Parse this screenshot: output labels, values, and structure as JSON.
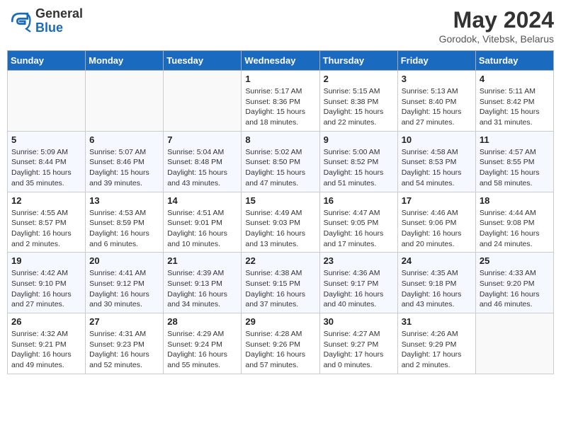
{
  "header": {
    "logo": {
      "line1": "General",
      "line2": "Blue"
    },
    "title": "May 2024",
    "location": "Gorodok, Vitebsk, Belarus"
  },
  "weekdays": [
    "Sunday",
    "Monday",
    "Tuesday",
    "Wednesday",
    "Thursday",
    "Friday",
    "Saturday"
  ],
  "weeks": [
    [
      {
        "day": "",
        "sunrise": "",
        "sunset": "",
        "daylight": ""
      },
      {
        "day": "",
        "sunrise": "",
        "sunset": "",
        "daylight": ""
      },
      {
        "day": "",
        "sunrise": "",
        "sunset": "",
        "daylight": ""
      },
      {
        "day": "1",
        "sunrise": "5:17 AM",
        "sunset": "8:36 PM",
        "daylight": "15 hours and 18 minutes."
      },
      {
        "day": "2",
        "sunrise": "5:15 AM",
        "sunset": "8:38 PM",
        "daylight": "15 hours and 22 minutes."
      },
      {
        "day": "3",
        "sunrise": "5:13 AM",
        "sunset": "8:40 PM",
        "daylight": "15 hours and 27 minutes."
      },
      {
        "day": "4",
        "sunrise": "5:11 AM",
        "sunset": "8:42 PM",
        "daylight": "15 hours and 31 minutes."
      }
    ],
    [
      {
        "day": "5",
        "sunrise": "5:09 AM",
        "sunset": "8:44 PM",
        "daylight": "15 hours and 35 minutes."
      },
      {
        "day": "6",
        "sunrise": "5:07 AM",
        "sunset": "8:46 PM",
        "daylight": "15 hours and 39 minutes."
      },
      {
        "day": "7",
        "sunrise": "5:04 AM",
        "sunset": "8:48 PM",
        "daylight": "15 hours and 43 minutes."
      },
      {
        "day": "8",
        "sunrise": "5:02 AM",
        "sunset": "8:50 PM",
        "daylight": "15 hours and 47 minutes."
      },
      {
        "day": "9",
        "sunrise": "5:00 AM",
        "sunset": "8:52 PM",
        "daylight": "15 hours and 51 minutes."
      },
      {
        "day": "10",
        "sunrise": "4:58 AM",
        "sunset": "8:53 PM",
        "daylight": "15 hours and 54 minutes."
      },
      {
        "day": "11",
        "sunrise": "4:57 AM",
        "sunset": "8:55 PM",
        "daylight": "15 hours and 58 minutes."
      }
    ],
    [
      {
        "day": "12",
        "sunrise": "4:55 AM",
        "sunset": "8:57 PM",
        "daylight": "16 hours and 2 minutes."
      },
      {
        "day": "13",
        "sunrise": "4:53 AM",
        "sunset": "8:59 PM",
        "daylight": "16 hours and 6 minutes."
      },
      {
        "day": "14",
        "sunrise": "4:51 AM",
        "sunset": "9:01 PM",
        "daylight": "16 hours and 10 minutes."
      },
      {
        "day": "15",
        "sunrise": "4:49 AM",
        "sunset": "9:03 PM",
        "daylight": "16 hours and 13 minutes."
      },
      {
        "day": "16",
        "sunrise": "4:47 AM",
        "sunset": "9:05 PM",
        "daylight": "16 hours and 17 minutes."
      },
      {
        "day": "17",
        "sunrise": "4:46 AM",
        "sunset": "9:06 PM",
        "daylight": "16 hours and 20 minutes."
      },
      {
        "day": "18",
        "sunrise": "4:44 AM",
        "sunset": "9:08 PM",
        "daylight": "16 hours and 24 minutes."
      }
    ],
    [
      {
        "day": "19",
        "sunrise": "4:42 AM",
        "sunset": "9:10 PM",
        "daylight": "16 hours and 27 minutes."
      },
      {
        "day": "20",
        "sunrise": "4:41 AM",
        "sunset": "9:12 PM",
        "daylight": "16 hours and 30 minutes."
      },
      {
        "day": "21",
        "sunrise": "4:39 AM",
        "sunset": "9:13 PM",
        "daylight": "16 hours and 34 minutes."
      },
      {
        "day": "22",
        "sunrise": "4:38 AM",
        "sunset": "9:15 PM",
        "daylight": "16 hours and 37 minutes."
      },
      {
        "day": "23",
        "sunrise": "4:36 AM",
        "sunset": "9:17 PM",
        "daylight": "16 hours and 40 minutes."
      },
      {
        "day": "24",
        "sunrise": "4:35 AM",
        "sunset": "9:18 PM",
        "daylight": "16 hours and 43 minutes."
      },
      {
        "day": "25",
        "sunrise": "4:33 AM",
        "sunset": "9:20 PM",
        "daylight": "16 hours and 46 minutes."
      }
    ],
    [
      {
        "day": "26",
        "sunrise": "4:32 AM",
        "sunset": "9:21 PM",
        "daylight": "16 hours and 49 minutes."
      },
      {
        "day": "27",
        "sunrise": "4:31 AM",
        "sunset": "9:23 PM",
        "daylight": "16 hours and 52 minutes."
      },
      {
        "day": "28",
        "sunrise": "4:29 AM",
        "sunset": "9:24 PM",
        "daylight": "16 hours and 55 minutes."
      },
      {
        "day": "29",
        "sunrise": "4:28 AM",
        "sunset": "9:26 PM",
        "daylight": "16 hours and 57 minutes."
      },
      {
        "day": "30",
        "sunrise": "4:27 AM",
        "sunset": "9:27 PM",
        "daylight": "17 hours and 0 minutes."
      },
      {
        "day": "31",
        "sunrise": "4:26 AM",
        "sunset": "9:29 PM",
        "daylight": "17 hours and 2 minutes."
      },
      {
        "day": "",
        "sunrise": "",
        "sunset": "",
        "daylight": ""
      }
    ]
  ]
}
